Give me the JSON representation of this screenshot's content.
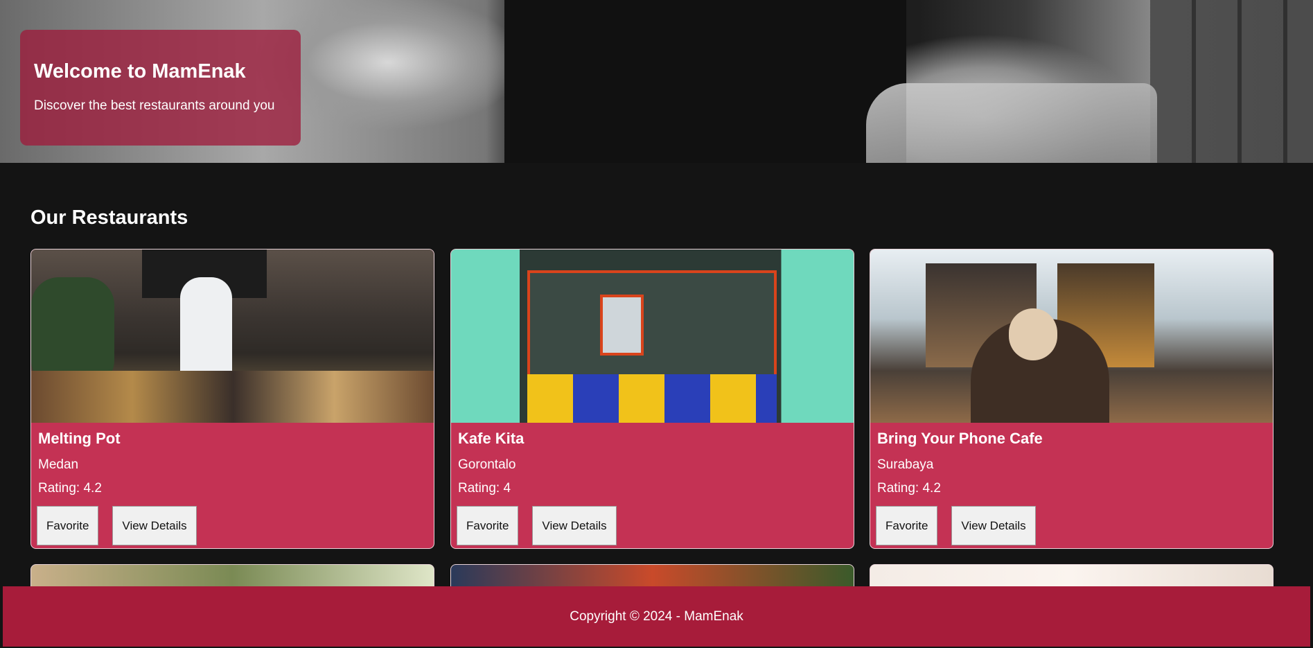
{
  "hero": {
    "title": "Welcome to MamEnak",
    "subtitle": "Discover the best restaurants around you"
  },
  "section": {
    "title": "Our Restaurants"
  },
  "restaurants": [
    {
      "name": "Melting Pot",
      "city": "Medan",
      "rating": "Rating: 4.2",
      "favorite_label": "Favorite",
      "details_label": "View Details"
    },
    {
      "name": "Kafe Kita",
      "city": "Gorontalo",
      "rating": "Rating: 4",
      "favorite_label": "Favorite",
      "details_label": "View Details"
    },
    {
      "name": "Bring Your Phone Cafe",
      "city": "Surabaya",
      "rating": "Rating: 4.2",
      "favorite_label": "Favorite",
      "details_label": "View Details"
    }
  ],
  "footer": {
    "text": "Copyright © 2024 - MamEnak"
  },
  "colors": {
    "background": "#141414",
    "card": "#c43254",
    "footer": "#a71c3a",
    "hero_overlay": "#9e1c3c"
  }
}
